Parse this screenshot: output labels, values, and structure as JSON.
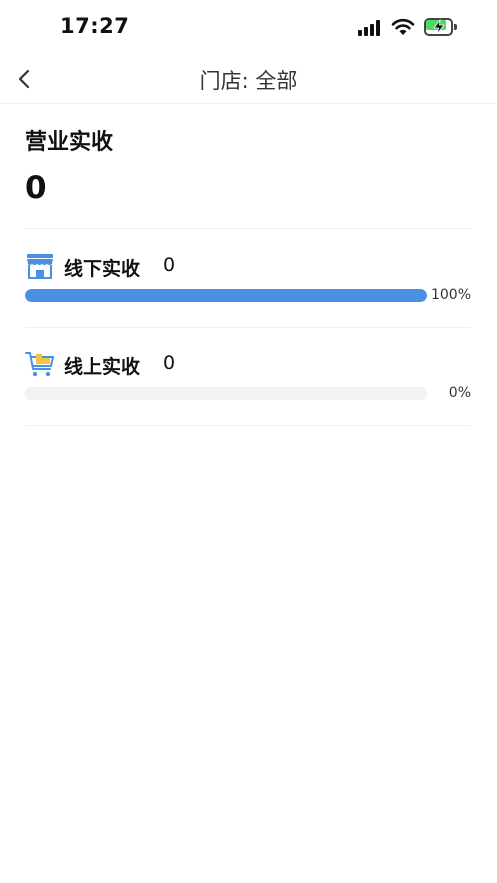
{
  "status_bar": {
    "time": "17:27",
    "icons": [
      "signal-icon",
      "wifi-icon",
      "battery-charging-icon"
    ],
    "battery_color": "#4cd964"
  },
  "nav": {
    "back_icon": "chevron-left-icon",
    "title": "门店: 全部"
  },
  "summary": {
    "label": "营业实收",
    "value": "0"
  },
  "sections": [
    {
      "icon": "storefront-icon",
      "label": "线下实收",
      "amount": "0",
      "progress": 1.0,
      "percent_text": "100%"
    },
    {
      "icon": "shopping-cart-icon",
      "label": "线上实收",
      "amount": "0",
      "progress": 0.0,
      "percent_text": "0%"
    }
  ],
  "colors": {
    "accent": "#4a90e2",
    "track": "#f2f2f2"
  }
}
